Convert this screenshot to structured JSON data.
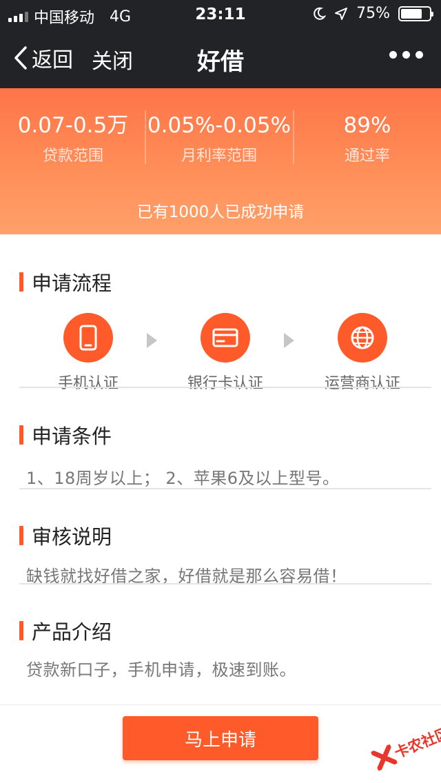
{
  "status_bar": {
    "carrier": "中国移动",
    "network": "4G",
    "time": "23:11",
    "battery": "75%",
    "battery_level": 0.75,
    "icons": [
      "signal-icon",
      "moon-icon",
      "location-arrow-icon",
      "battery-icon"
    ]
  },
  "nav": {
    "back_label": "返回",
    "close_label": "关闭",
    "title": "好借",
    "more_icon": "more-dots-icon"
  },
  "hero": {
    "stats": [
      {
        "value": "0.07-0.5万",
        "label": "贷款范围"
      },
      {
        "value": "0.05%-0.05%",
        "label": "月利率范围"
      },
      {
        "value": "89%",
        "label": "通过率"
      }
    ],
    "note": "已有1000人已成功申请"
  },
  "process": {
    "title": "申请流程",
    "steps": [
      {
        "label": "手机认证",
        "icon": "phone-icon"
      },
      {
        "label": "银行卡认证",
        "icon": "bank-card-icon"
      },
      {
        "label": "运营商认证",
        "icon": "globe-icon"
      }
    ]
  },
  "conditions": {
    "title": "申请条件",
    "text": "1、18周岁以上；  2、苹果6及以上型号。"
  },
  "review": {
    "title": "审核说明",
    "text": "缺钱就找好借之家，好借就是那么容易借！"
  },
  "intro": {
    "title": "产品介绍",
    "text": "贷款新口子，手机申请，极速到账。"
  },
  "apply_button": "马上申请",
  "watermark": "卡农社区",
  "colors": {
    "accent": "#ff5b2a",
    "nav_bg": "#222327",
    "hero_top": "#fe7448",
    "hero_bottom": "#ffa06a"
  }
}
